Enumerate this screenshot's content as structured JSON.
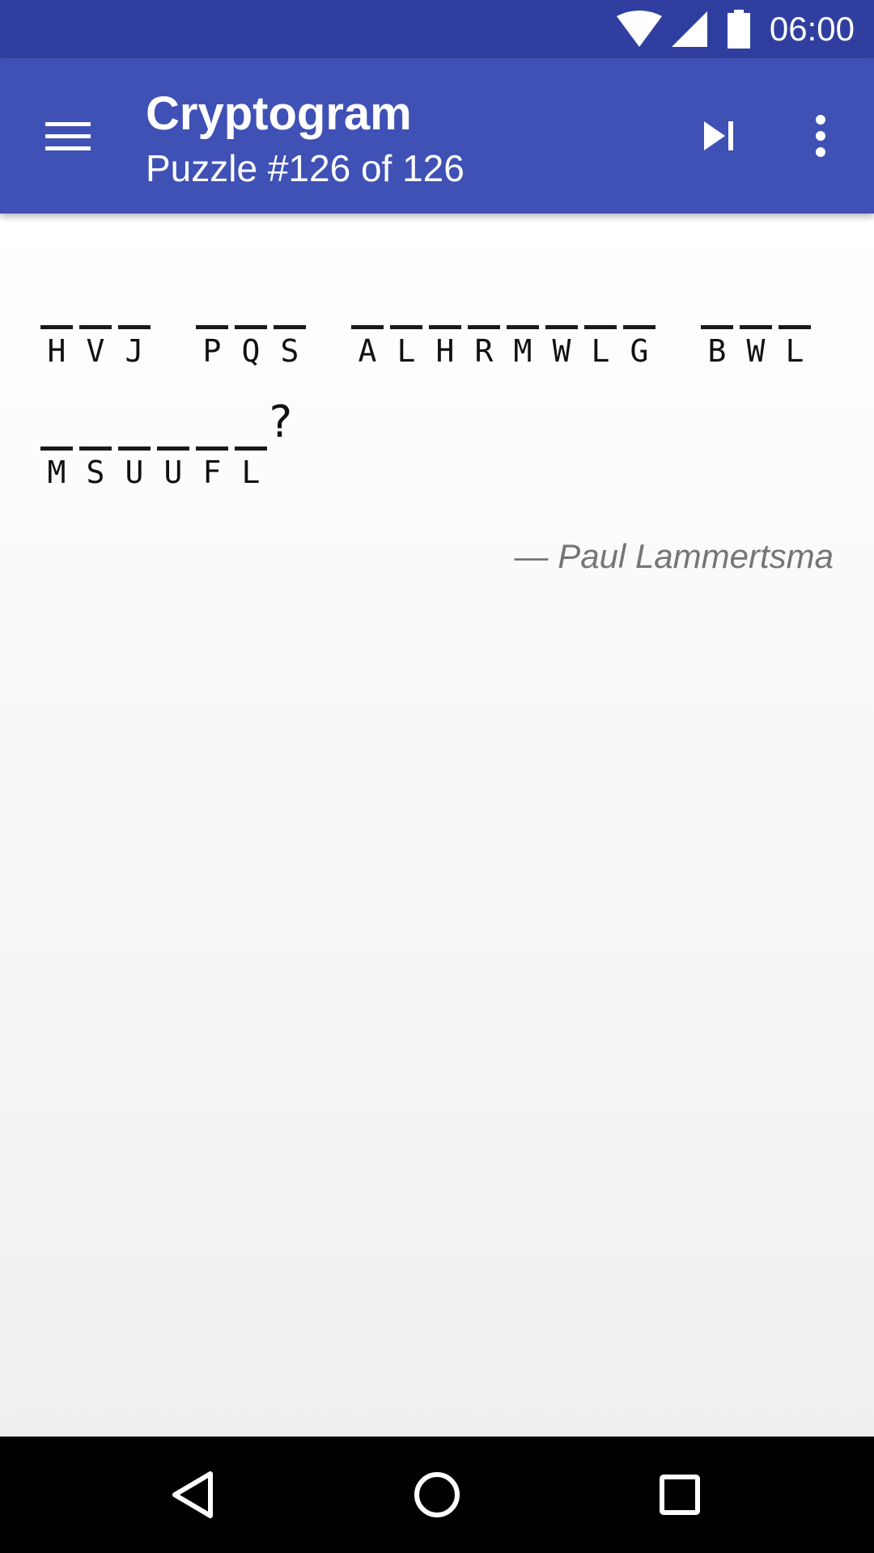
{
  "status_bar": {
    "time": "06:00",
    "icons": [
      "wifi-icon",
      "cell-signal-icon",
      "battery-icon"
    ]
  },
  "app_bar": {
    "title": "Cryptogram",
    "subtitle": "Puzzle #126 of 126",
    "icons": [
      "menu-icon",
      "skip-next-icon",
      "more-vert-icon"
    ]
  },
  "puzzle": {
    "lines": [
      {
        "words": [
          {
            "letters": [
              "H",
              "V",
              "J"
            ],
            "punct": ""
          },
          {
            "letters": [
              "P",
              "Q",
              "S"
            ],
            "punct": ""
          },
          {
            "letters": [
              "A",
              "L",
              "H",
              "R",
              "M",
              "W",
              "L",
              "G"
            ],
            "punct": ""
          },
          {
            "letters": [
              "B",
              "W",
              "L"
            ],
            "punct": ""
          }
        ]
      },
      {
        "words": [
          {
            "letters": [
              "M",
              "S",
              "U",
              "U",
              "F",
              "L"
            ],
            "punct": "?"
          }
        ]
      }
    ],
    "author": "— Paul Lammertsma"
  },
  "nav_bar": {
    "icons": [
      "back-icon",
      "home-icon",
      "recents-icon"
    ]
  },
  "colors": {
    "status_bar": "#303f9f",
    "app_bar": "#3f51b5",
    "nav_bar": "#000000",
    "author_text": "#757575"
  }
}
